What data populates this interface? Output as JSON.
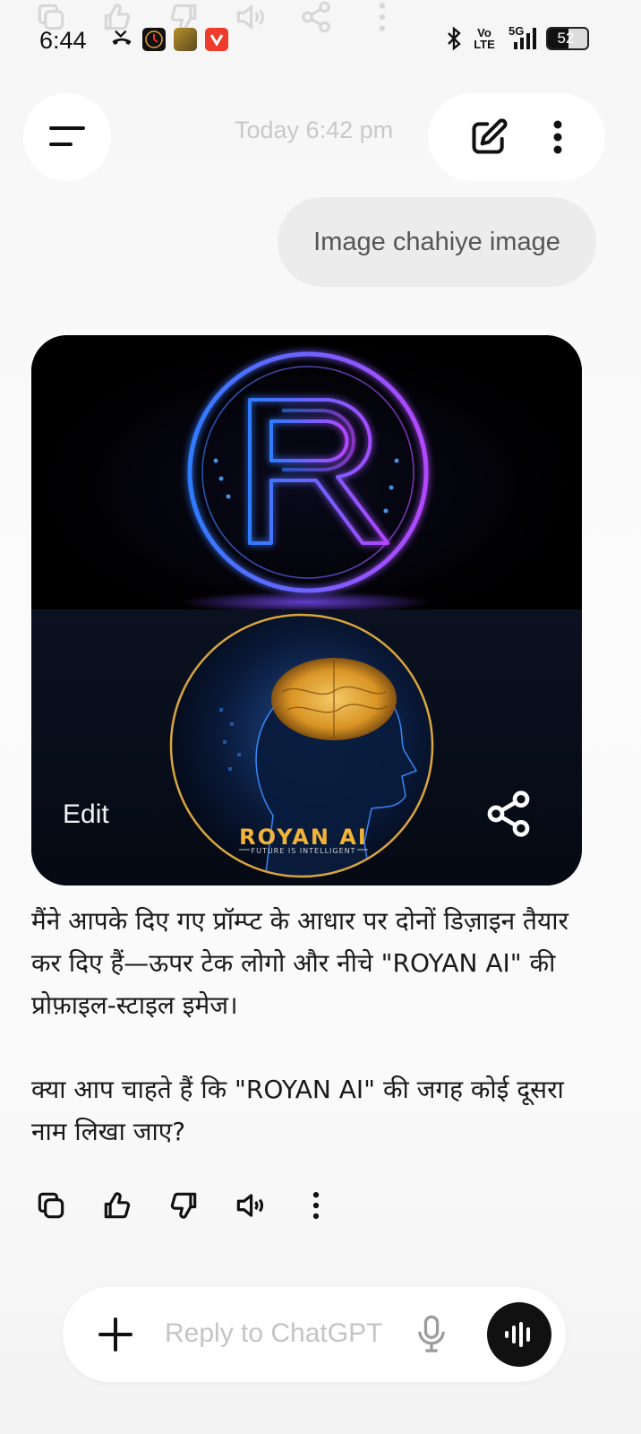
{
  "status_bar": {
    "time": "6:44",
    "network_label": "Vo LTE",
    "network_5g": "5G",
    "battery_level": "52",
    "icons": [
      "missed-call-icon",
      "clock-app-icon",
      "photo-app-icon",
      "v-app-icon",
      "bluetooth-icon",
      "signal-icon",
      "battery-icon"
    ]
  },
  "header": {
    "timestamp": "Today 6:42 pm",
    "icons": [
      "menu-icon",
      "new-chat-icon",
      "more-vertical-icon"
    ]
  },
  "user_message": {
    "text": "Image chahiye image"
  },
  "image_card": {
    "top_logo_letter": "R",
    "brand_text": "ROYAN AI",
    "tagline": "FUTURE IS INTELLIGENT",
    "edit_label": "Edit",
    "share_icon": "share-icon",
    "colors": {
      "blue": "#2f7bff",
      "purple": "#b347ff",
      "gold": "#f2b338"
    }
  },
  "assistant_reply": {
    "paragraphs": [
      "मैंने आपके दिए गए प्रॉम्प्ट के आधार पर दोनों डिज़ाइन तैयार कर दिए हैं—ऊपर टेक लोगो और नीचे \"ROYAN AI\" की प्रोफ़ाइल-स्टाइल इमेज।",
      "क्या आप चाहते हैं कि \"ROYAN AI\" की जगह कोई दूसरा नाम लिखा जाए?"
    ]
  },
  "reply_actions": [
    "copy-icon",
    "thumbs-up-icon",
    "thumbs-down-icon",
    "read-aloud-icon",
    "more-vertical-icon"
  ],
  "composer": {
    "placeholder": "Reply to ChatGPT",
    "icons": [
      "plus-icon",
      "mic-icon",
      "voice-mode-icon"
    ]
  }
}
